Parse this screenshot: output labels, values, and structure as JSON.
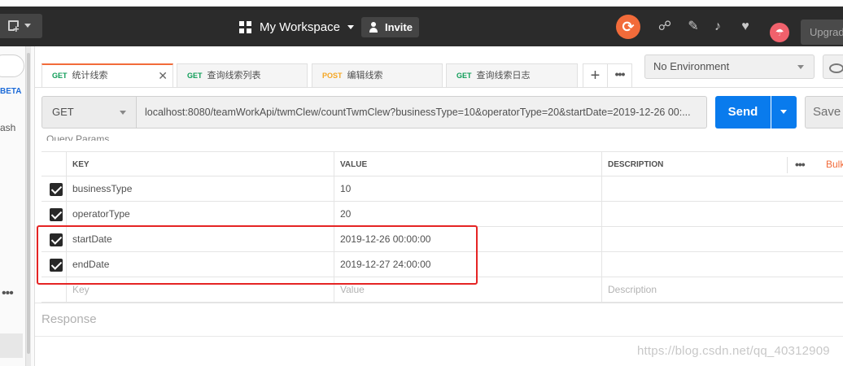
{
  "topbar": {
    "workspace_label": "My Workspace",
    "invite_label": "Invite",
    "upgrade_label": "Upgrad"
  },
  "sidebar": {
    "beta_label": "BETA",
    "trash_label": "ash"
  },
  "tabs": [
    {
      "method": "GET",
      "title": "统计线索",
      "active": true
    },
    {
      "method": "GET",
      "title": "查询线索列表",
      "active": false
    },
    {
      "method": "POST",
      "title": "编辑线索",
      "active": false
    },
    {
      "method": "GET",
      "title": "查询线索日志",
      "active": false
    }
  ],
  "environment": {
    "selected": "No Environment"
  },
  "request": {
    "method": "GET",
    "url": "localhost:8080/teamWorkApi/twmClew/countTwmClew?businessType=10&operatorType=20&startDate=2019-12-26 00:...",
    "send_label": "Send",
    "save_label": "Save"
  },
  "params": {
    "section_label": "Query Params",
    "headers": {
      "key": "KEY",
      "value": "VALUE",
      "description": "DESCRIPTION",
      "bulk": "Bulk"
    },
    "rows": [
      {
        "key": "businessType",
        "value": "10",
        "description": "",
        "checked": true
      },
      {
        "key": "operatorType",
        "value": "20",
        "description": "",
        "checked": true
      },
      {
        "key": "startDate",
        "value": "2019-12-26 00:00:00",
        "description": "",
        "checked": true
      },
      {
        "key": "endDate",
        "value": "2019-12-27 24:00:00",
        "description": "",
        "checked": true
      }
    ],
    "placeholders": {
      "key": "Key",
      "value": "Value",
      "description": "Description"
    }
  },
  "response": {
    "label": "Response"
  },
  "watermark": "https://blog.csdn.net/qq_40312909",
  "colors": {
    "accent": "#f26b3a",
    "send": "#097bed",
    "get": "#0f9d58",
    "post": "#f5a623",
    "highlight_box": "#e52424"
  }
}
